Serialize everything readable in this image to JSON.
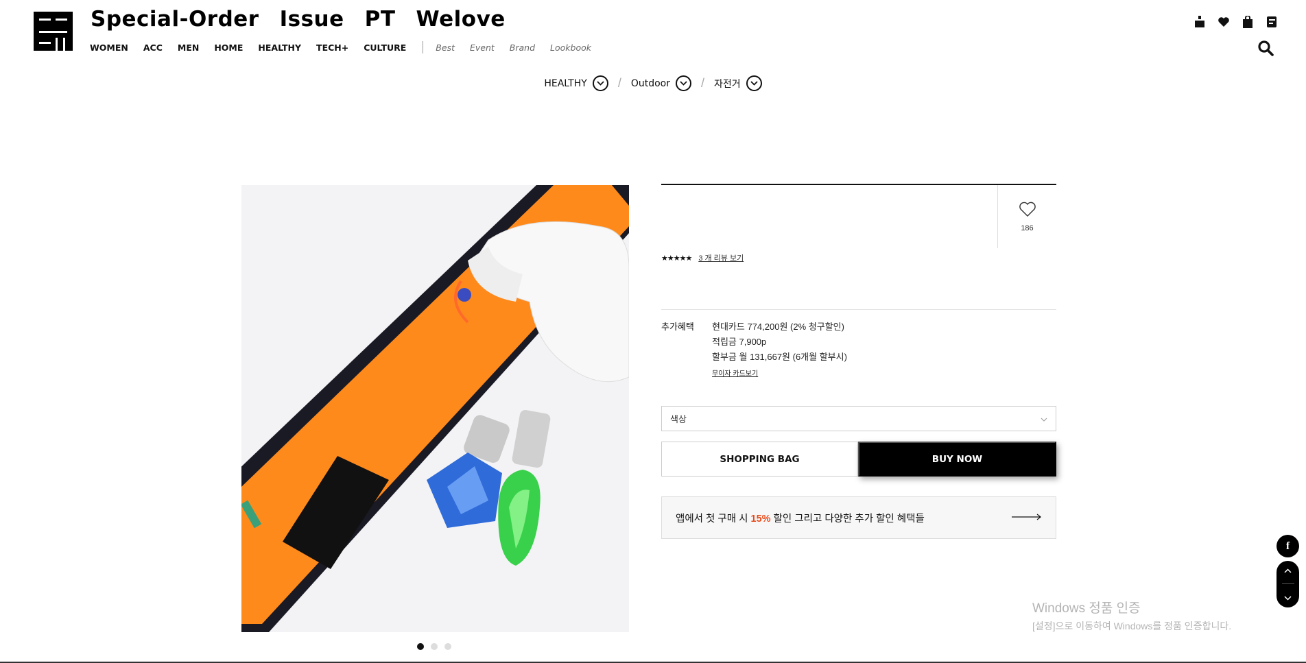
{
  "header": {
    "brand_links": [
      "Special-Order",
      "Issue",
      "PT",
      "Welove"
    ],
    "main_nav": [
      "WOMEN",
      "ACC",
      "MEN",
      "HOME",
      "HEALTHY",
      "TECH+",
      "CULTURE"
    ],
    "sub_nav": [
      "Best",
      "Event",
      "Brand",
      "Lookbook"
    ],
    "icons": [
      "mypage-icon",
      "heart-icon",
      "shopping-bag-icon",
      "menu-icon",
      "search-icon"
    ]
  },
  "breadcrumb": {
    "items": [
      "HEALTHY",
      "Outdoor",
      "자전거"
    ],
    "separator": "/"
  },
  "product": {
    "like_count": "186",
    "stars": "★★★★★",
    "review_link": "3 개 리뷰 보기",
    "benefits_label": "추가혜택",
    "benefits": [
      "현대카드 774,200원 (2% 청구할인)",
      "적립금 7,900p",
      "할부금 월 131,667원 (6개월 할부시)"
    ],
    "card_link": "무이자 카드보기",
    "option_placeholder": "색상",
    "shopping_bag_label": "SHOPPING BAG",
    "buy_now_label": "BUY NOW",
    "promo": {
      "prefix": "앱에서 첫 구매 시 ",
      "highlight": "15%",
      "suffix": " 할인 그리고 다양한 추가 할인 혜택들"
    },
    "image_dots": 3,
    "active_dot": 0
  },
  "floating": {
    "facebook_label": "f"
  },
  "watermark": {
    "line1": "Windows 정품 인증",
    "line2": "[설정]으로 이동하여 Windows를 정품 인증합니다."
  },
  "colors": {
    "accent": "#e84b1a",
    "strap_orange": "#ff8c1a",
    "black": "#000000"
  }
}
